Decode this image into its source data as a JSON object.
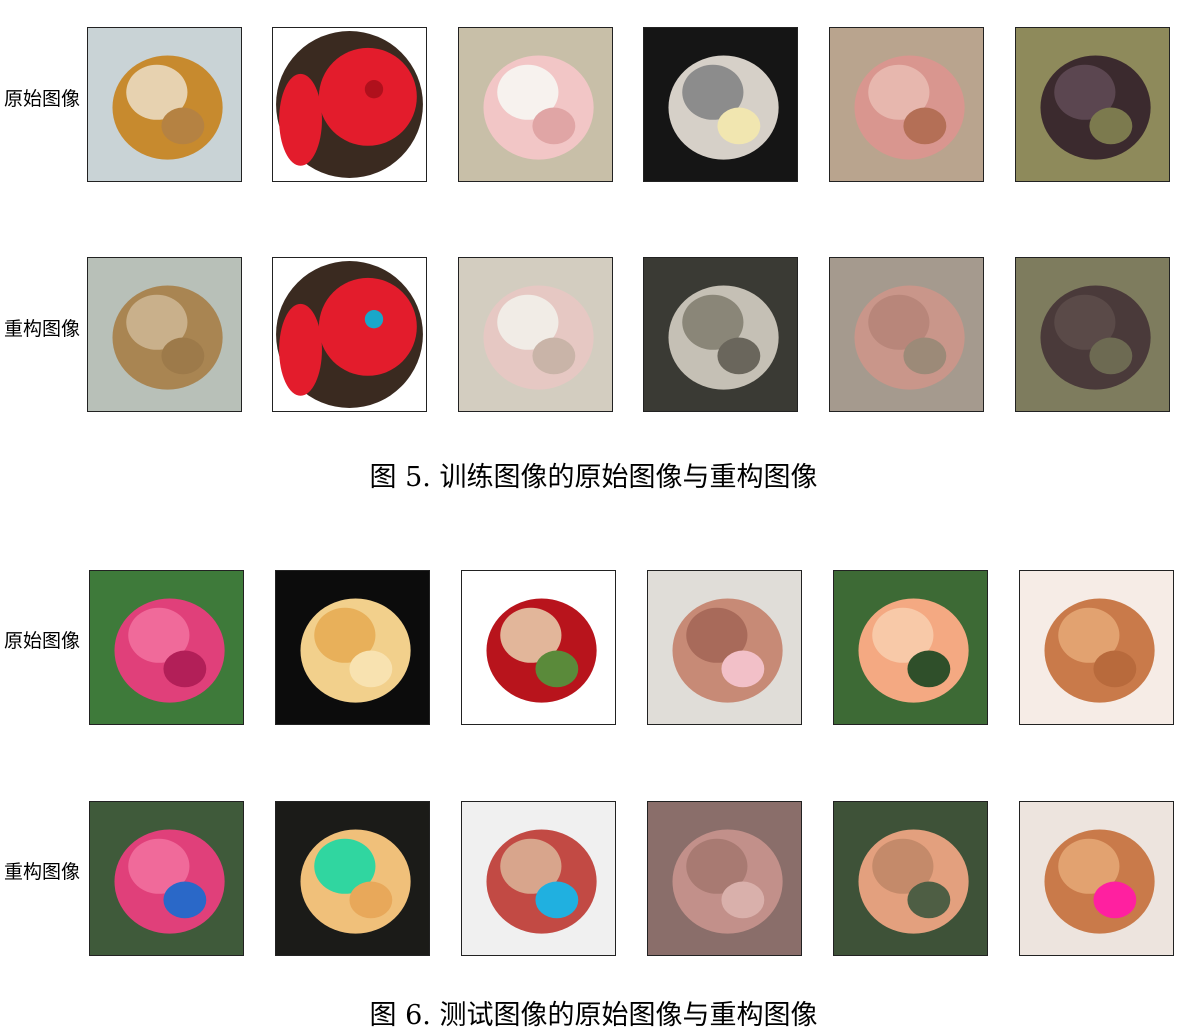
{
  "figures": [
    {
      "caption": "图 5.  训练图像的原始图像与重构图像",
      "rows": [
        {
          "label": "原始图像",
          "images": [
            {
              "name": "cream-rose",
              "bg": "#c9d3d6",
              "blobs": [
                "#c78a2e",
                "#e7d2b0",
                "#b58242"
              ],
              "circle": false
            },
            {
              "name": "red-rose-circle",
              "bg": "#ffffff",
              "blobs": [
                "#e31c2c",
                "#b0101c",
                "#3a2a20"
              ],
              "circle": true
            },
            {
              "name": "baby-pink-hat",
              "bg": "#c8bfa8",
              "blobs": [
                "#f2c6c6",
                "#f7f2ee",
                "#e0a5a5"
              ],
              "circle": false
            },
            {
              "name": "baby-dress-black",
              "bg": "#151515",
              "blobs": [
                "#d6d0c8",
                "#8c8c8c",
                "#f1e6b0"
              ],
              "circle": false
            },
            {
              "name": "newborn-hands",
              "bg": "#b9a48e",
              "blobs": [
                "#d9968f",
                "#e7b7ae",
                "#b46f56"
              ],
              "circle": false
            },
            {
              "name": "dark-dog",
              "bg": "#8e8a5b",
              "blobs": [
                "#3b2a2e",
                "#5b4650",
                "#7c7a4e"
              ],
              "circle": false
            }
          ]
        },
        {
          "label": "重构图像",
          "images": [
            {
              "name": "cream-rose-recon",
              "bg": "#b8c0b8",
              "blobs": [
                "#a98552",
                "#c9b08b",
                "#9d7a4a"
              ],
              "circle": false
            },
            {
              "name": "red-rose-recon",
              "bg": "#ffffff",
              "blobs": [
                "#e31c2c",
                "#1aa7c9",
                "#3a2a20"
              ],
              "circle": true
            },
            {
              "name": "baby-recon",
              "bg": "#d3cdc0",
              "blobs": [
                "#e6c8c3",
                "#f1ece6",
                "#c9b4a8"
              ],
              "circle": false
            },
            {
              "name": "dress-recon",
              "bg": "#3a3a34",
              "blobs": [
                "#c5c0b5",
                "#8a8678",
                "#6a665c"
              ],
              "circle": false
            },
            {
              "name": "newborn-recon",
              "bg": "#a59a8e",
              "blobs": [
                "#c9968a",
                "#b8867a",
                "#9c8a78"
              ],
              "circle": false
            },
            {
              "name": "dog-recon",
              "bg": "#7e7c5e",
              "blobs": [
                "#4a3a3a",
                "#5a4a48",
                "#6d6a52"
              ],
              "circle": false
            }
          ]
        }
      ]
    },
    {
      "caption": "图 6.  测试图像的原始图像与重构图像",
      "rows": [
        {
          "label": "原始图像",
          "images": [
            {
              "name": "pink-rose",
              "bg": "#3e7a3a",
              "blobs": [
                "#e0407a",
                "#f06a9a",
                "#b21f58"
              ],
              "circle": false
            },
            {
              "name": "yellow-rose",
              "bg": "#0c0c0c",
              "blobs": [
                "#f2d08c",
                "#e8b05a",
                "#f8e2b0"
              ],
              "circle": false
            },
            {
              "name": "rose-in-hand",
              "bg": "#ffffff",
              "blobs": [
                "#b8141c",
                "#e2b69a",
                "#5a8a3a"
              ],
              "circle": false
            },
            {
              "name": "baby-face",
              "bg": "#e0ddd8",
              "blobs": [
                "#c78a76",
                "#a86a5a",
                "#f2c0c8"
              ],
              "circle": false
            },
            {
              "name": "peach-rose",
              "bg": "#3d6a35",
              "blobs": [
                "#f4a982",
                "#f8c9a8",
                "#2f4f2a"
              ],
              "circle": false
            },
            {
              "name": "bread-shapes",
              "bg": "#f6ece6",
              "blobs": [
                "#c97a4a",
                "#e2a270",
                "#b86a3c"
              ],
              "circle": false
            }
          ]
        },
        {
          "label": "重构图像",
          "images": [
            {
              "name": "pink-rose-recon",
              "bg": "#3f5a3a",
              "blobs": [
                "#e0407a",
                "#f06a9a",
                "#2a68c8"
              ],
              "circle": false
            },
            {
              "name": "yellow-rose-recon",
              "bg": "#1b1b18",
              "blobs": [
                "#f0c07a",
                "#30d6a0",
                "#e8a85a"
              ],
              "circle": false
            },
            {
              "name": "rose-in-hand-recon",
              "bg": "#f0f0f0",
              "blobs": [
                "#c24a44",
                "#d8a58c",
                "#20b0e0"
              ],
              "circle": false
            },
            {
              "name": "baby-face-recon",
              "bg": "#8a6e6a",
              "blobs": [
                "#c2908a",
                "#a87a72",
                "#d9b0ab"
              ],
              "circle": false
            },
            {
              "name": "peach-rose-recon",
              "bg": "#3e5238",
              "blobs": [
                "#e3a07e",
                "#c48a6a",
                "#4e5e44"
              ],
              "circle": false
            },
            {
              "name": "bread-recon",
              "bg": "#ede4de",
              "blobs": [
                "#c97a4a",
                "#e2a270",
                "#ff20a0"
              ],
              "circle": false
            }
          ]
        }
      ]
    }
  ]
}
